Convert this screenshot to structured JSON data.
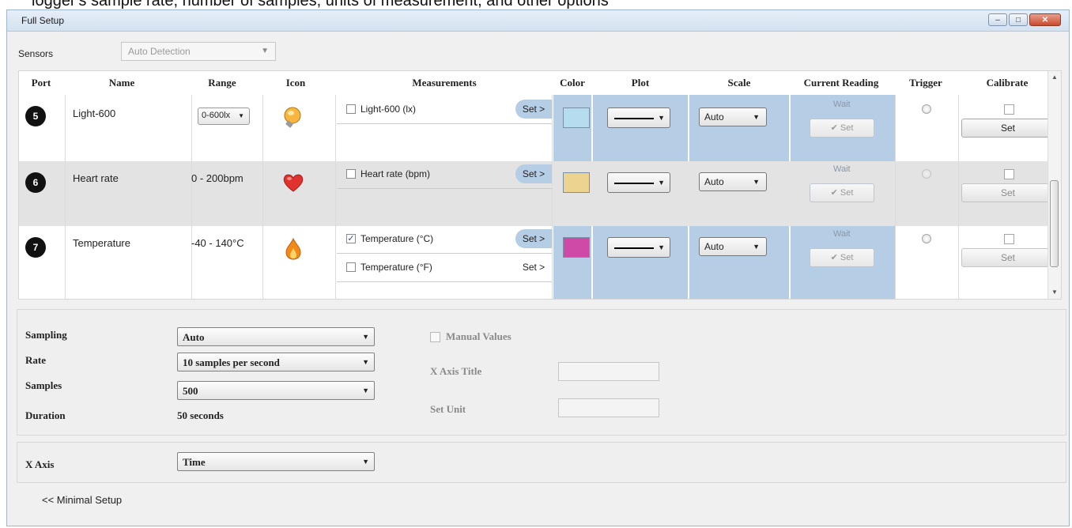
{
  "caption_partial": "logger's sample rate, number of samples, units of measurement, and other options",
  "window": {
    "title": "Full Setup",
    "minimize_glyph": "–",
    "maximize_glyph": "□",
    "close_glyph": "✕"
  },
  "sensors": {
    "label": "Sensors",
    "value": "Auto Detection",
    "arrow": "▼"
  },
  "table": {
    "headers": {
      "port": "Port",
      "name": "Name",
      "range": "Range",
      "icon": "Icon",
      "measurements": "Measurements",
      "color": "Color",
      "plot": "Plot",
      "scale": "Scale",
      "current_reading": "Current Reading",
      "trigger": "Trigger",
      "calibrate": "Calibrate"
    },
    "rows": [
      {
        "port": "5",
        "name": "Light-600",
        "range": "0-600lx",
        "range_is_select": true,
        "icon": "light-bulb-icon",
        "measurements": [
          {
            "label": "Light-600 (lx)",
            "checked": false,
            "set": "Set >"
          }
        ],
        "color": "#b5dcef",
        "scale": "Auto",
        "reading": "Wait",
        "reading_set": "Set",
        "calibrate_set": "Set"
      },
      {
        "port": "6",
        "name": "Heart rate",
        "range": "0 - 200bpm",
        "range_is_select": false,
        "icon": "heart-icon",
        "measurements": [
          {
            "label": "Heart rate (bpm)",
            "checked": false,
            "set": "Set >"
          }
        ],
        "color": "#ecd38f",
        "scale": "Auto",
        "reading": "Wait",
        "reading_set": "Set",
        "calibrate_set": "Set"
      },
      {
        "port": "7",
        "name": "Temperature",
        "range": "-40 - 140°C",
        "range_is_select": false,
        "icon": "flame-icon",
        "measurements": [
          {
            "label": "Temperature (°C)",
            "checked": true,
            "set": "Set >"
          },
          {
            "label": "Temperature (°F)",
            "checked": false,
            "set": "Set >"
          }
        ],
        "color": "#cf4aa6",
        "scale": "Auto",
        "reading": "Wait",
        "reading_set": "Set",
        "calibrate_set": "Set"
      }
    ]
  },
  "sampling": {
    "sampling_label": "Sampling",
    "sampling_value": "Auto",
    "rate_label": "Rate",
    "rate_value": "10 samples per second",
    "samples_label": "Samples",
    "samples_value": "500",
    "duration_label": "Duration",
    "duration_value": "50 seconds",
    "manual_values_label": "Manual Values",
    "x_axis_title_label": "X Axis Title",
    "set_unit_label": "Set Unit"
  },
  "x_axis": {
    "label": "X Axis",
    "value": "Time"
  },
  "footer": {
    "minimal_setup": "<< Minimal Setup"
  },
  "symbols": {
    "dropdown_arrow": "▼",
    "checkmark": "✓",
    "set_check": "✔"
  }
}
